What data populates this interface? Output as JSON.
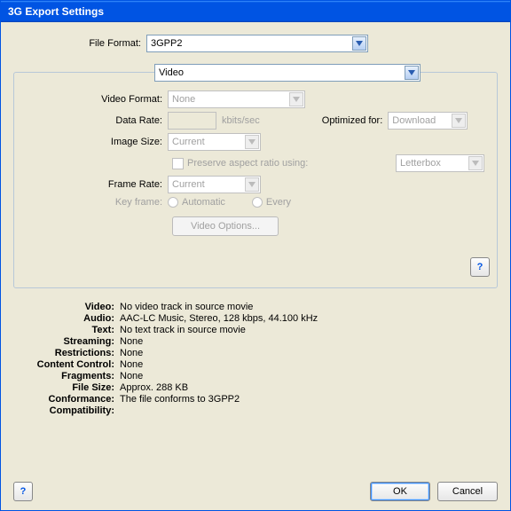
{
  "title": "3G Export Settings",
  "file_format": {
    "label": "File Format:",
    "value": "3GPP2"
  },
  "tab": {
    "value": "Video"
  },
  "video_format": {
    "label": "Video Format:",
    "value": "None"
  },
  "data_rate": {
    "label": "Data Rate:",
    "value": "",
    "unit": "kbits/sec"
  },
  "optimized": {
    "label": "Optimized for:",
    "value": "Download"
  },
  "image_size": {
    "label": "Image Size:",
    "value": "Current"
  },
  "preserve": {
    "label": "Preserve aspect ratio using:",
    "value": "Letterbox"
  },
  "frame_rate": {
    "label": "Frame Rate:",
    "value": "Current"
  },
  "key_frame": {
    "label": "Key frame:",
    "auto": "Automatic",
    "every": "Every"
  },
  "video_options_btn": "Video Options...",
  "help_char": "?",
  "summary": {
    "video": {
      "label": "Video:",
      "value": "No video track in source movie"
    },
    "audio": {
      "label": "Audio:",
      "value": "AAC-LC Music, Stereo, 128 kbps, 44.100 kHz"
    },
    "text": {
      "label": "Text:",
      "value": "No text track in source movie"
    },
    "stream": {
      "label": "Streaming:",
      "value": "None"
    },
    "restr": {
      "label": "Restrictions:",
      "value": "None"
    },
    "content": {
      "label": "Content Control:",
      "value": "None"
    },
    "frag": {
      "label": "Fragments:",
      "value": "None"
    },
    "size": {
      "label": "File Size:",
      "value": "Approx. 288 KB"
    },
    "conf": {
      "label": "Conformance:",
      "value": "The file conforms to 3GPP2"
    },
    "compat": {
      "label": "Compatibility:",
      "value": ""
    }
  },
  "buttons": {
    "ok": "OK",
    "cancel": "Cancel"
  }
}
